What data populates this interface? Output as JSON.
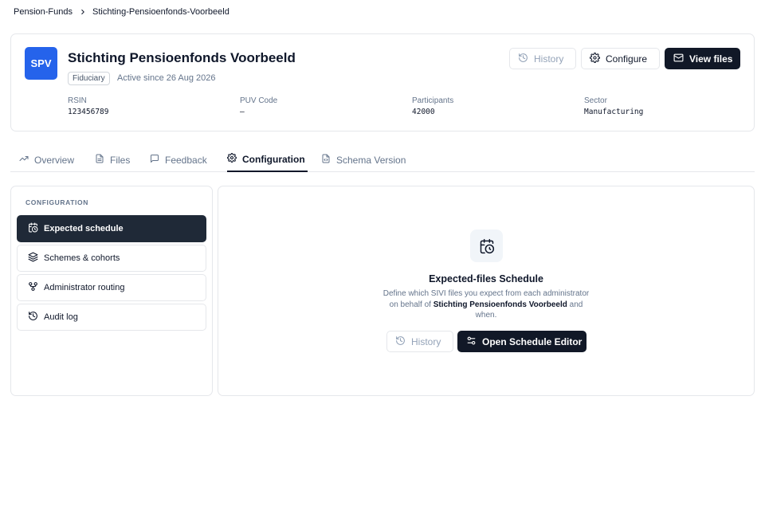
{
  "breadcrumb": {
    "root": "Pension-Funds",
    "current": "Stichting-Pensioenfonds-Voorbeeld"
  },
  "fund": {
    "logo_text": "SPV",
    "name": "Stichting Pensioenfonds Voorbeeld",
    "badge": "Fiduciary",
    "active_since": "Active since 26 Aug 2026"
  },
  "actions": {
    "history": "History",
    "configure": "Configure",
    "view_files": "View files"
  },
  "stats": [
    {
      "label": "RSIN",
      "value": "123456789"
    },
    {
      "label": "PUV Code",
      "value": "–"
    },
    {
      "label": "Participants",
      "value": "42000"
    },
    {
      "label": "Sector",
      "value": "Manufacturing"
    }
  ],
  "tabs": [
    {
      "label": "Overview",
      "icon": "trend-icon"
    },
    {
      "label": "Files",
      "icon": "file-icon"
    },
    {
      "label": "Feedback",
      "icon": "message-icon"
    },
    {
      "label": "Configuration",
      "icon": "gear-icon",
      "active": true
    },
    {
      "label": "Schema Version",
      "icon": "file-code-icon"
    }
  ],
  "sidebar": {
    "heading": "CONFIGURATION",
    "items": [
      {
        "label": "Expected schedule",
        "icon": "calendar-clock-icon",
        "active": true
      },
      {
        "label": "Schemes & cohorts",
        "icon": "layers-icon"
      },
      {
        "label": "Administrator routing",
        "icon": "routing-icon"
      },
      {
        "label": "Audit log",
        "icon": "history-icon"
      }
    ]
  },
  "main": {
    "icon": "calendar-clock-icon",
    "title": "Expected-files Schedule",
    "desc_prefix": "Define which SIVI files you expect from each administrator on behalf of",
    "desc_fund": "Stichting Pensioenfonds Voorbeeld",
    "desc_suffix": "and when.",
    "history_button": "History",
    "editor_button": "Open Schedule Editor"
  },
  "colors": {
    "brand": "#2563eb",
    "dark": "#111827",
    "border": "#e5e7eb",
    "muted": "#64748b"
  }
}
